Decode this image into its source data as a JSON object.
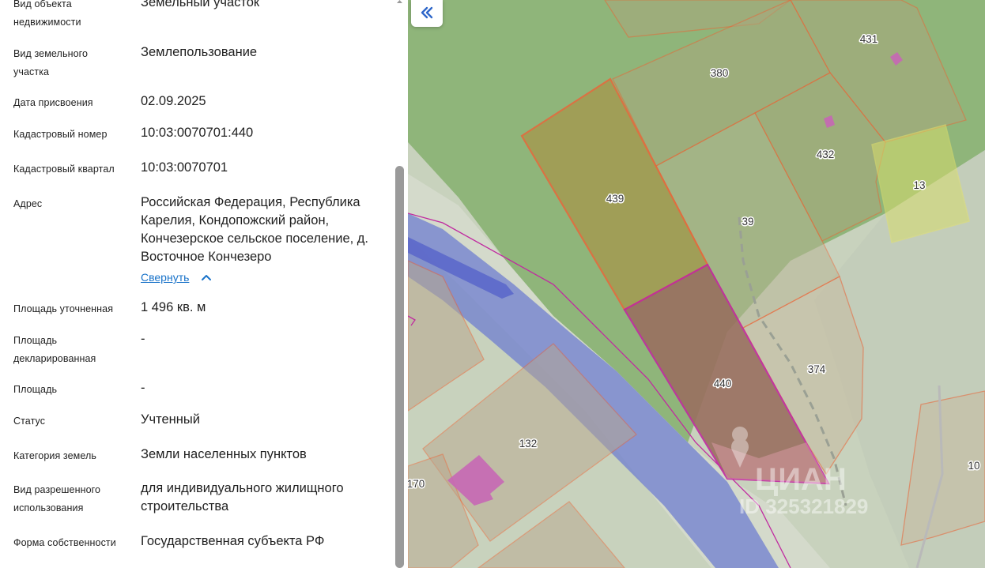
{
  "panel": {
    "rows": [
      {
        "label": "Вид объекта недвижимости",
        "value": "Земельный участок"
      },
      {
        "label": "Вид земельного участка",
        "value": "Землепользование"
      },
      {
        "label": "Дата присвоения",
        "value": "02.09.2025"
      },
      {
        "label": "Кадастровый номер",
        "value": "10:03:0070701:440"
      },
      {
        "label": "Кадастровый квартал",
        "value": "10:03:0070701"
      },
      {
        "label": "Адрес",
        "value": "Российская Федерация, Республика Карелия, Кондопожский район, Кончезерское сельское поселение, д. Восточное Кончезеро"
      },
      {
        "label": "Площадь уточненная",
        "value": "1 496 кв. м"
      },
      {
        "label": "Площадь декларированная",
        "value": "-"
      },
      {
        "label": "Площадь",
        "value": "-"
      },
      {
        "label": "Статус",
        "value": "Учтенный"
      },
      {
        "label": "Категория земель",
        "value": "Земли населенных пунктов"
      },
      {
        "label": "Вид разрешенного использования",
        "value": "для индивидуального жилищного строительства"
      },
      {
        "label": "Форма собственности",
        "value": "Государственная субъекта РФ"
      }
    ],
    "collapse_label": "Свернуть"
  },
  "map": {
    "back_button_icon": "double-chevron-left-icon",
    "parcels": [
      "380",
      "431",
      "432",
      "439",
      "39",
      "13",
      "440",
      "374",
      "132",
      "170",
      "10"
    ],
    "watermark": {
      "brand": "ЦИАН",
      "id": "ID 325321829"
    }
  },
  "colors": {
    "link": "#1a73c9",
    "parcel_border": "#e8673a",
    "selected_border": "#c02aa0",
    "road": "#6f7dd0",
    "forest": "#8fb57a"
  }
}
